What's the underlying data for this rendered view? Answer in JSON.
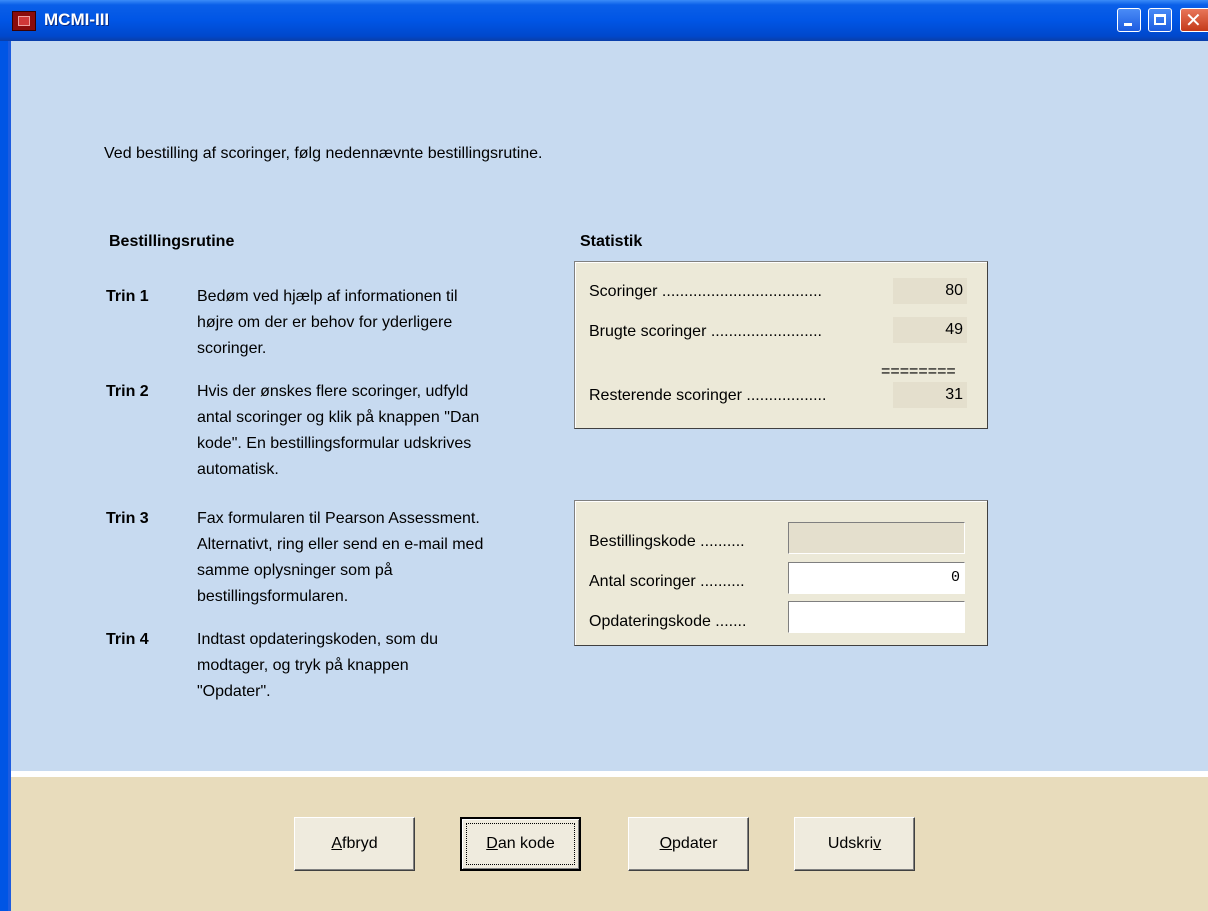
{
  "window": {
    "title": "MCMI-III"
  },
  "intro": "Ved bestilling af scoringer, følg nedennævnte bestillingsrutine.",
  "steps": {
    "heading": "Bestillingsrutine",
    "items": [
      {
        "label": "Trin 1",
        "lines": [
          "Bedøm ved hjælp af informationen til",
          "højre om der er behov for yderligere",
          "scoringer."
        ]
      },
      {
        "label": "Trin 2",
        "lines": [
          "Hvis der ønskes flere scoringer, udfyld",
          "antal scoringer og klik på knappen \"Dan",
          "kode\". En bestillingsformular udskrives",
          "automatisk."
        ]
      },
      {
        "label": "Trin 3",
        "lines": [
          "Fax formularen til Pearson Assessment.",
          "Alternativt, ring eller send en e-mail med",
          "samme oplysninger som på",
          "bestillingsformularen."
        ]
      },
      {
        "label": "Trin 4",
        "lines": [
          "Indtast opdateringskoden, som du",
          "modtager, og tryk på knappen",
          "\"Opdater\"."
        ]
      }
    ]
  },
  "statistics": {
    "heading": "Statistik",
    "rows": [
      {
        "label": "Scoringer ....................................",
        "value": "80"
      },
      {
        "label": "Brugte scoringer .........................",
        "value": "49"
      },
      {
        "label": "Resterende scoringer ..................",
        "value": "31"
      }
    ],
    "separator": "========"
  },
  "order_form": {
    "rows": [
      {
        "label": "Bestillingskode ..........",
        "value": ""
      },
      {
        "label": "Antal scoringer ..........",
        "value": "0"
      },
      {
        "label": "Opdateringskode .......",
        "value": ""
      }
    ]
  },
  "buttons": {
    "cancel": {
      "pre": "",
      "key": "A",
      "post": "fbryd"
    },
    "generate": {
      "pre": "",
      "key": "D",
      "post": "an kode"
    },
    "update": {
      "pre": "",
      "key": "O",
      "post": "pdater"
    },
    "print": {
      "pre": "Udskri",
      "key": "v",
      "post": ""
    }
  },
  "colors": {
    "titlebar": "#0055e5",
    "content_bg": "#c7daf0",
    "footer_bg": "#e8dcbc",
    "panel_bg": "#ece9d8"
  }
}
